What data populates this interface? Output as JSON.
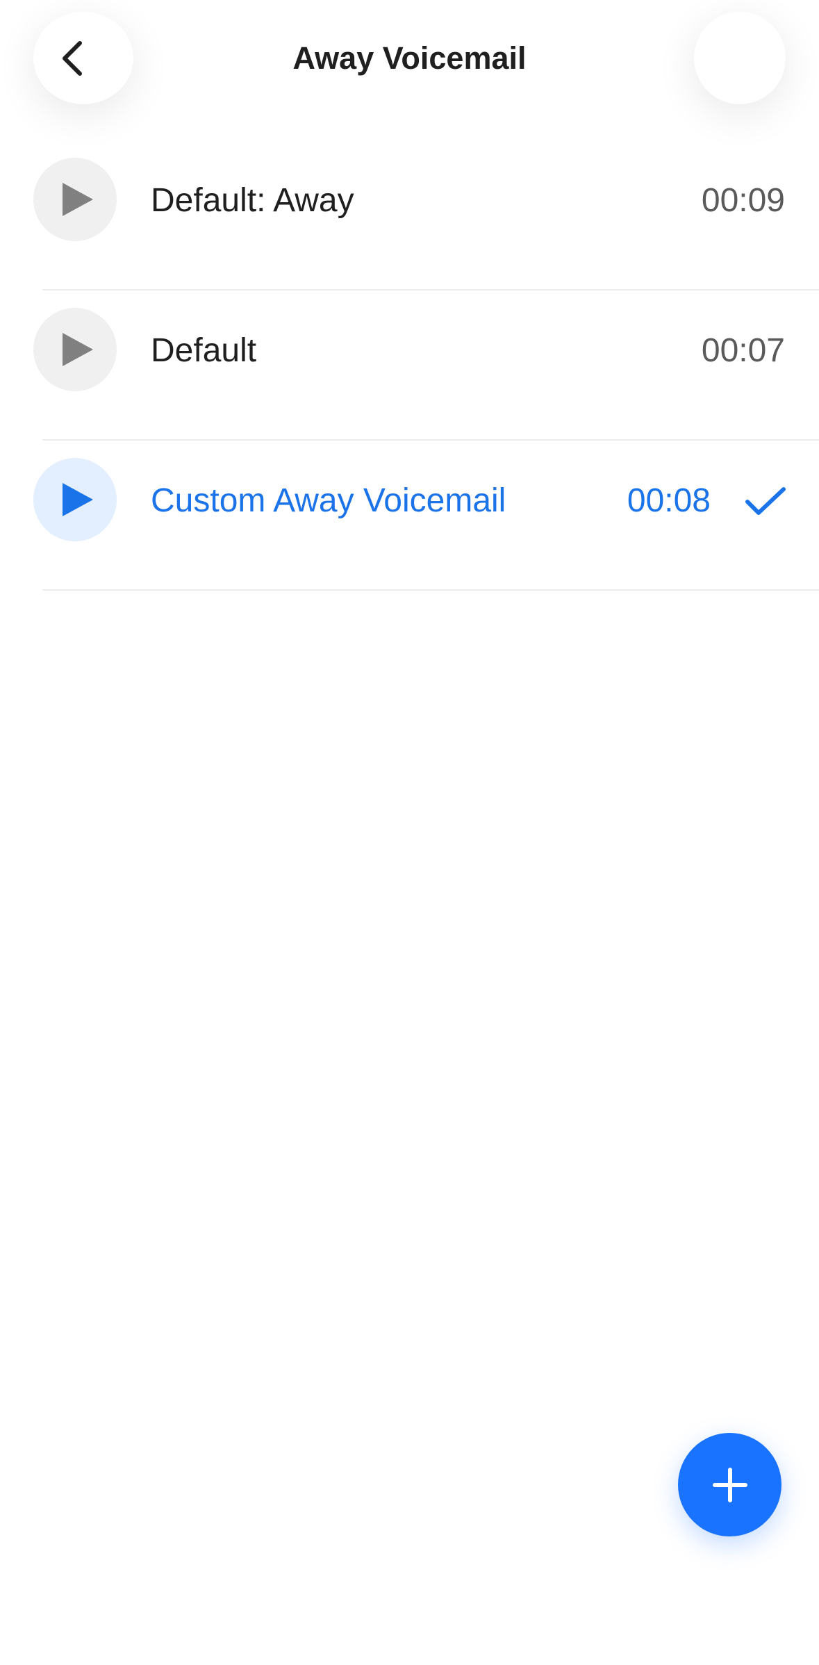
{
  "header": {
    "title": "Away Voicemail",
    "back_icon": "chevron-left-icon"
  },
  "colors": {
    "accent": "#1a73ff",
    "selected_text": "#1a73e8",
    "play_bg": "#f0f0f0",
    "play_bg_selected": "#e3efff",
    "play_icon": "#808080"
  },
  "voicemails": [
    {
      "label": "Default: Away",
      "duration": "00:09",
      "selected": false
    },
    {
      "label": "Default",
      "duration": "00:07",
      "selected": false
    },
    {
      "label": "Custom Away Voicemail",
      "duration": "00:08",
      "selected": true
    }
  ],
  "fab": {
    "icon": "plus-icon"
  }
}
